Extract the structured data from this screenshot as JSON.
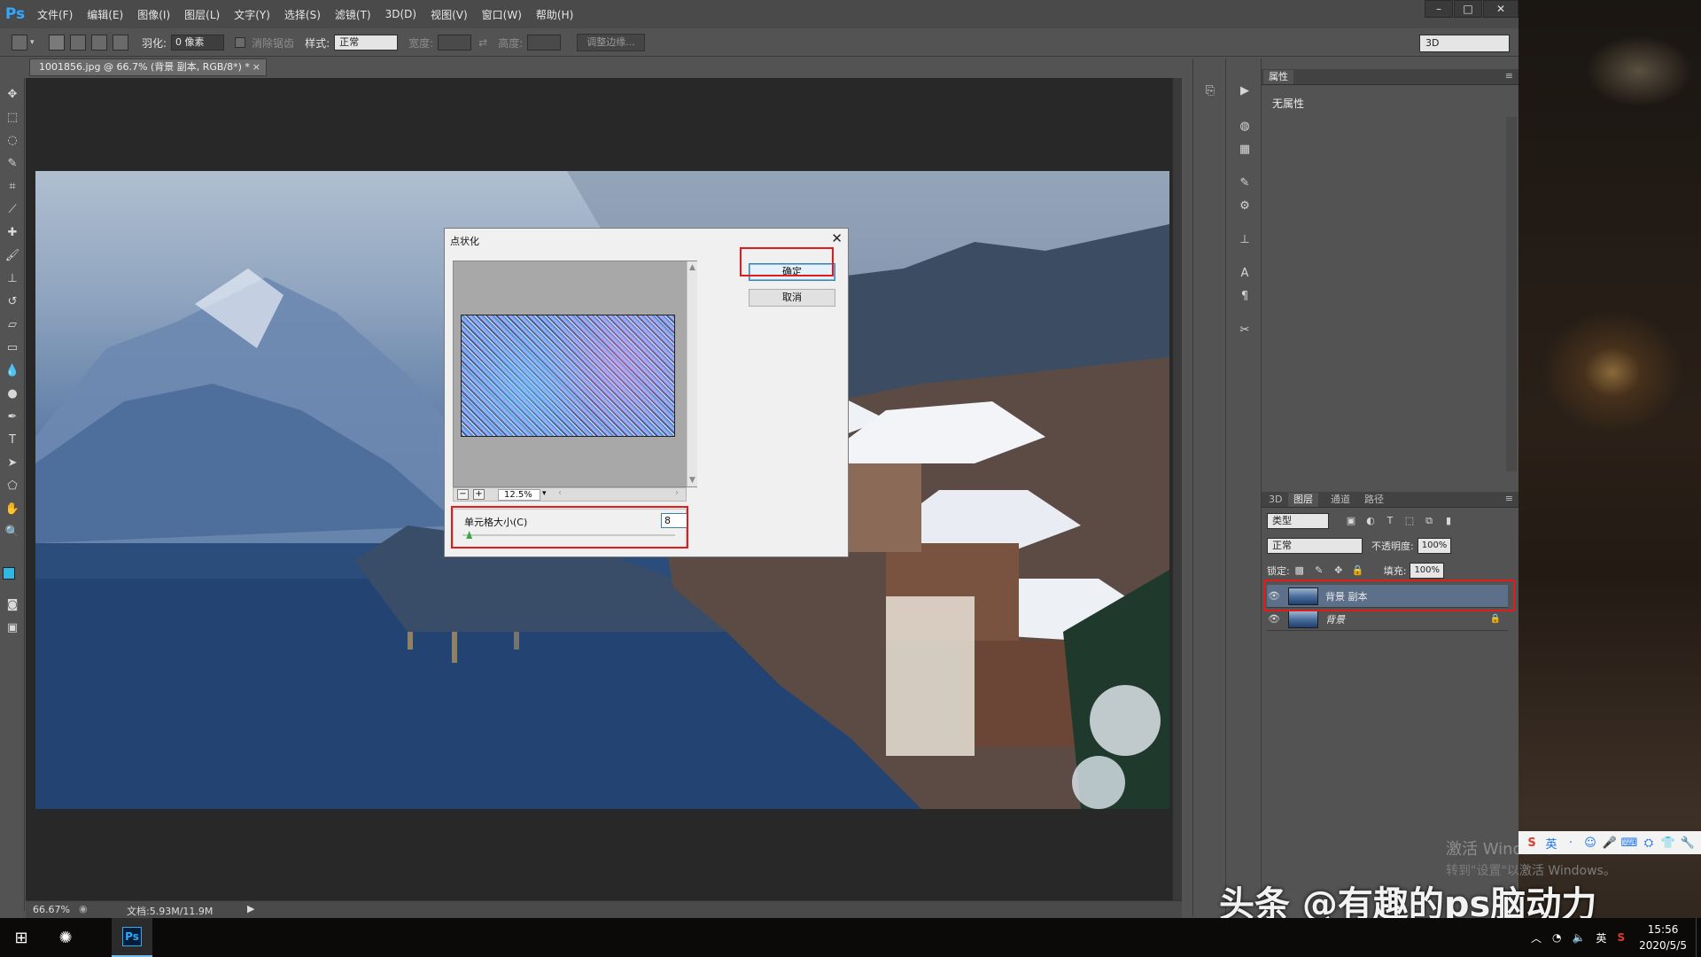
{
  "menubar": {
    "logo": "Ps",
    "items": [
      "文件(F)",
      "编辑(E)",
      "图像(I)",
      "图层(L)",
      "文字(Y)",
      "选择(S)",
      "滤镜(T)",
      "3D(D)",
      "视图(V)",
      "窗口(W)",
      "帮助(H)"
    ],
    "window_controls": [
      "–",
      "□",
      "✕"
    ]
  },
  "options": {
    "feather_label": "羽化:",
    "feather_value": "0 像素",
    "antialias_label": "消除锯齿",
    "style_label": "样式:",
    "style_value": "正常",
    "width_label": "宽度:",
    "height_label": "高度:",
    "refine_edge": "调整边缘...",
    "workspace": "3D"
  },
  "document": {
    "tab_title": "1001856.jpg @ 66.7% (背景 副本, RGB/8*) *",
    "tab_close": "×",
    "zoom": "66.67%",
    "doc_size": "文档:5.93M/11.9M"
  },
  "dialog": {
    "title": "点状化",
    "close": "✕",
    "ok": "确定",
    "cancel": "取消",
    "zoom_out": "−",
    "zoom_in": "+",
    "zoom_value": "12.5%",
    "cell_size_label": "单元格大小(C)",
    "cell_size_value": "8",
    "cell_size_fraction": 0.03
  },
  "panels": {
    "properties_tab": "属性",
    "no_properties": "无属性",
    "layer_tabs": [
      "3D",
      "图层",
      "通道",
      "路径"
    ],
    "kind_label": "类型",
    "blend_mode": "正常",
    "opacity_label": "不透明度:",
    "opacity_value": "100%",
    "lock_label": "锁定:",
    "fill_label": "填充:",
    "fill_value": "100%",
    "layers": [
      {
        "name": "背景 副本",
        "selected": true
      },
      {
        "name": "背景",
        "selected": false
      }
    ]
  },
  "desktop": {
    "activation_line1": "激活 Windows",
    "activation_line2": "转到\"设置\"以激活 Windows。",
    "watermark": "头条 @有趣的ps脑动力",
    "ime_items": [
      "S",
      "英",
      "·",
      "☺",
      "🎤",
      "⌨",
      "⛭",
      "👕",
      "🔧"
    ]
  },
  "taskbar": {
    "ps_label": "Ps",
    "tray_lang": "英",
    "time": "15:56",
    "date": "2020/5/5"
  },
  "colors": {
    "accent_blue": "#31a8ff",
    "highlight_red": "#e21c1c",
    "foreground_color": "#2fb8e4",
    "background_color": "#ffffff"
  }
}
